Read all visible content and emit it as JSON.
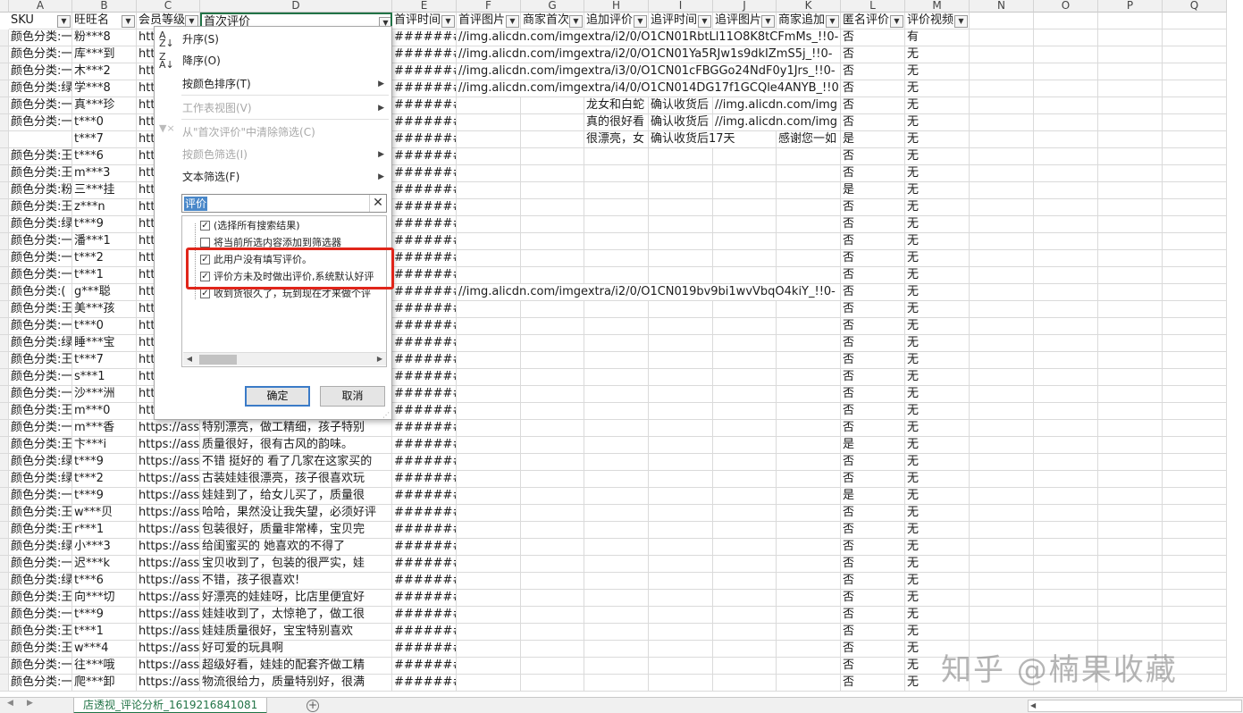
{
  "columns": [
    "A",
    "B",
    "C",
    "D",
    "E",
    "F",
    "G",
    "H",
    "I",
    "J",
    "K",
    "L",
    "M",
    "N",
    "O",
    "P",
    "Q"
  ],
  "headers": [
    "SKU",
    "旺旺名",
    "会员等级",
    "首次评价",
    "首评时间",
    "首评图片",
    "商家首次",
    "追加评价",
    "追评时间",
    "追评图片",
    "商家追加",
    "匿名评价",
    "评价视频"
  ],
  "rows": [
    {
      "a": "颜色分类:一",
      "b": "粉***8",
      "c": "htt",
      "e": "#######",
      "f": "//img.alicdn.com/imgextra/i2/0/O1CN01RbtLl11O8K8tCFmMs_!!0-",
      "l": "否",
      "m": "有"
    },
    {
      "a": "颜色分类:一",
      "b": "库***到",
      "c": "htt",
      "e": "#######",
      "f": "//img.alicdn.com/imgextra/i2/0/O1CN01Ya5RJw1s9dkIZmS5j_!!0-",
      "l": "否",
      "m": "无"
    },
    {
      "a": "颜色分类:一",
      "b": "木***2",
      "c": "htt",
      "e": "#######",
      "f": "//img.alicdn.com/imgextra/i3/0/O1CN01cFBGGo24NdF0y1Jrs_!!0-",
      "l": "否",
      "m": "无"
    },
    {
      "a": "颜色分类:绿",
      "b": "学***8",
      "c": "htt",
      "e": "#######",
      "f": "//img.alicdn.com/imgextra/i4/0/O1CN014DG17f1GCQle4ANYB_!!0",
      "l": "否",
      "m": "无"
    },
    {
      "a": "颜色分类:一",
      "b": "真***珍",
      "c": "htt",
      "e": "#######",
      "h": "龙女和白蛇",
      "i": "确认收货后",
      "j": "//img.alicdn.com/img",
      "l": "否",
      "m": "无"
    },
    {
      "a": "颜色分类:一",
      "b": "t***0",
      "c": "htt",
      "e": "#######",
      "h": "真的很好看",
      "i": "确认收货后",
      "j": "//img.alicdn.com/img",
      "l": "否",
      "m": "无"
    },
    {
      "a": "",
      "b": "t***7",
      "c": "htt",
      "e": "#######",
      "h": "很漂亮，女",
      "i": "确认收货后17天",
      "k": "感谢您一如",
      "l": "是",
      "m": "无"
    },
    {
      "a": "颜色分类:王",
      "b": "t***6",
      "c": "htt",
      "e": "#######",
      "l": "否",
      "m": "无"
    },
    {
      "a": "颜色分类:王",
      "b": "m***3",
      "c": "htt",
      "e": "#######",
      "l": "否",
      "m": "无"
    },
    {
      "a": "颜色分类:粉",
      "b": "三***挂",
      "c": "htt",
      "e": "#######",
      "l": "是",
      "m": "无"
    },
    {
      "a": "颜色分类:王",
      "b": "z***n",
      "c": "htt",
      "e": "#######",
      "l": "否",
      "m": "无"
    },
    {
      "a": "颜色分类:绿",
      "b": "t***9",
      "c": "htt",
      "e": "#######",
      "l": "否",
      "m": "无"
    },
    {
      "a": "颜色分类:一",
      "b": "潘***1",
      "c": "htt",
      "e": "#######",
      "l": "否",
      "m": "无"
    },
    {
      "a": "颜色分类:一",
      "b": "t***2",
      "c": "htt",
      "e": "#######",
      "l": "否",
      "m": "无"
    },
    {
      "a": "颜色分类:一",
      "b": "t***1",
      "c": "htt",
      "e": "#######",
      "l": "否",
      "m": "无"
    },
    {
      "a": "颜色分类:(",
      "b": "g***聪",
      "c": "htt",
      "e": "#######",
      "f": "//img.alicdn.com/imgextra/i2/0/O1CN019bv9bi1wvVbqO4kiY_!!0-",
      "l": "否",
      "m": "无"
    },
    {
      "a": "颜色分类:王",
      "b": "美***孩",
      "c": "htt",
      "e": "#######",
      "l": "否",
      "m": "无"
    },
    {
      "a": "颜色分类:一",
      "b": "t***0",
      "c": "htt",
      "e": "#######",
      "l": "否",
      "m": "无"
    },
    {
      "a": "颜色分类:绿",
      "b": "睡***宝",
      "c": "htt",
      "e": "#######",
      "l": "否",
      "m": "无"
    },
    {
      "a": "颜色分类:王",
      "b": "t***7",
      "c": "htt",
      "e": "#######",
      "l": "否",
      "m": "无"
    },
    {
      "a": "颜色分类:一",
      "b": "s***1",
      "c": "htt",
      "e": "#######",
      "l": "否",
      "m": "无"
    },
    {
      "a": "颜色分类:一",
      "b": "沙***洲",
      "c": "htt",
      "e": "#######",
      "l": "否",
      "m": "无"
    },
    {
      "a": "颜色分类:王",
      "b": "m***0",
      "c": "htt",
      "e": "#######",
      "l": "否",
      "m": "无"
    },
    {
      "a": "颜色分类:一",
      "b": "m***香",
      "c": "https://ass",
      "d": "特别漂亮，做工精细，孩子特别",
      "e": "#######",
      "l": "否",
      "m": "无"
    },
    {
      "a": "颜色分类:王",
      "b": "卞***i",
      "c": "https://ass",
      "d": "质量很好，很有古风的韵味。",
      "e": "#######",
      "l": "是",
      "m": "无"
    },
    {
      "a": "颜色分类:绿",
      "b": "t***9",
      "c": "https://ass",
      "d": "不错 挺好的 看了几家在这家买的",
      "e": "#######",
      "l": "否",
      "m": "无"
    },
    {
      "a": "颜色分类:绿",
      "b": "t***2",
      "c": "https://ass",
      "d": "古装娃娃很漂亮，孩子很喜欢玩",
      "e": "#######",
      "l": "否",
      "m": "无"
    },
    {
      "a": "颜色分类:一",
      "b": "t***9",
      "c": "https://ass",
      "d": "娃娃到了，给女儿买了，质量很",
      "e": "#######",
      "l": "是",
      "m": "无"
    },
    {
      "a": "颜色分类:王",
      "b": "w***贝",
      "c": "https://ass",
      "d": "哈哈，果然没让我失望，必须好评",
      "e": "#######",
      "l": "否",
      "m": "无"
    },
    {
      "a": "颜色分类:王",
      "b": "r***1",
      "c": "https://ass",
      "d": "包装很好，质量非常棒，宝贝完",
      "e": "#######",
      "l": "否",
      "m": "无"
    },
    {
      "a": "颜色分类:绿",
      "b": "小***3",
      "c": "https://ass",
      "d": "给闺蜜买的 她喜欢的不得了",
      "e": "#######",
      "l": "否",
      "m": "无"
    },
    {
      "a": "颜色分类:一",
      "b": "迟***k",
      "c": "https://ass",
      "d": "宝贝收到了，包装的很严实，娃",
      "e": "#######",
      "l": "否",
      "m": "无"
    },
    {
      "a": "颜色分类:绿",
      "b": "t***6",
      "c": "https://ass",
      "d": "不错，孩子很喜欢!",
      "e": "#######",
      "l": "否",
      "m": "无"
    },
    {
      "a": "颜色分类:王",
      "b": "向***切",
      "c": "https://ass",
      "d": "好漂亮的娃娃呀，比店里便宜好",
      "e": "#######",
      "l": "否",
      "m": "无"
    },
    {
      "a": "颜色分类:一",
      "b": "t***9",
      "c": "https://ass",
      "d": "娃娃收到了，太惊艳了，做工很",
      "e": "#######",
      "l": "否",
      "m": "无"
    },
    {
      "a": "颜色分类:王",
      "b": "t***1",
      "c": "https://ass",
      "d": "娃娃质量很好，宝宝特别喜欢",
      "e": "#######",
      "l": "否",
      "m": "无"
    },
    {
      "a": "颜色分类:王",
      "b": "w***4",
      "c": "https://ass",
      "d": "好可爱的玩具啊",
      "e": "#######",
      "l": "否",
      "m": "无"
    },
    {
      "a": "颜色分类:一",
      "b": "往***哦",
      "c": "https://ass",
      "d": "超级好看，娃娃的配套齐做工精",
      "e": "#######",
      "l": "否",
      "m": "无"
    },
    {
      "a": "颜色分类:一",
      "b": "爬***卸",
      "c": "https://ass",
      "d": "物流很给力，质量特别好，很满",
      "e": "#######",
      "l": "否",
      "m": "无"
    }
  ],
  "filter_menu": {
    "sort_asc": "升序(S)",
    "sort_desc": "降序(O)",
    "sort_by_color": "按颜色排序(T)",
    "sheet_view": "工作表视图(V)",
    "clear_filter": "从\"首次评价\"中清除筛选(C)",
    "filter_by_color": "按颜色筛选(I)",
    "text_filters": "文本筛选(F)",
    "search_value": "评价",
    "items": [
      {
        "label": "(选择所有搜索结果)",
        "checked": true
      },
      {
        "label": "将当前所选内容添加到筛选器",
        "checked": false
      },
      {
        "label": "此用户没有填写评价。",
        "checked": true
      },
      {
        "label": "评价方未及时做出评价,系统默认好评",
        "checked": true
      },
      {
        "label": "收到货很久了，玩到现在才来做个评",
        "checked": true
      }
    ],
    "ok_label": "确定",
    "cancel_label": "取消"
  },
  "sheet_tab": "店透视_评论分析_1619216841081",
  "watermark": "知乎 @楠果收藏",
  "colors": {
    "accent": "#217346",
    "highlight": "#e0251a",
    "selection": "#4a88c9"
  }
}
